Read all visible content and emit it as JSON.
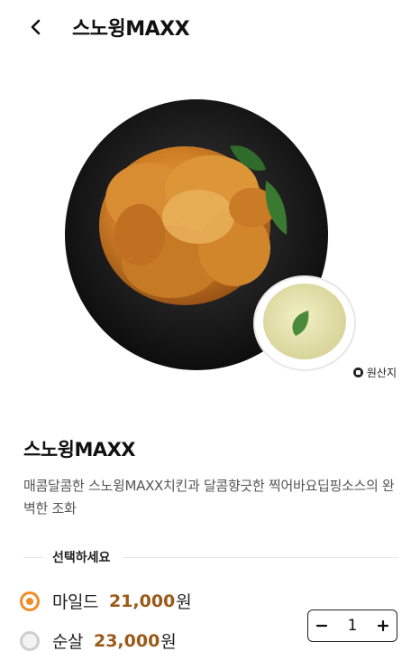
{
  "header": {
    "title": "스노윙MAXX",
    "back_icon": "chevron-left-icon"
  },
  "hero": {
    "origin_label": "원산지"
  },
  "product": {
    "name": "스노윙MAXX",
    "description": "매콤달콤한 스노윙MAXX치킨과 달콤향긋한 찍어바요딥핑소스의 완벽한 조화"
  },
  "options": {
    "section_label": "선택하세요",
    "items": [
      {
        "name": "마일드",
        "price": "21,000",
        "unit": "원",
        "selected": true
      },
      {
        "name": "순살",
        "price": "23,000",
        "unit": "원",
        "selected": false
      }
    ]
  },
  "quantity": {
    "minus": "−",
    "value": "1",
    "plus": "+"
  },
  "colors": {
    "accent": "#f28c28",
    "price": "#9a5a1a"
  }
}
